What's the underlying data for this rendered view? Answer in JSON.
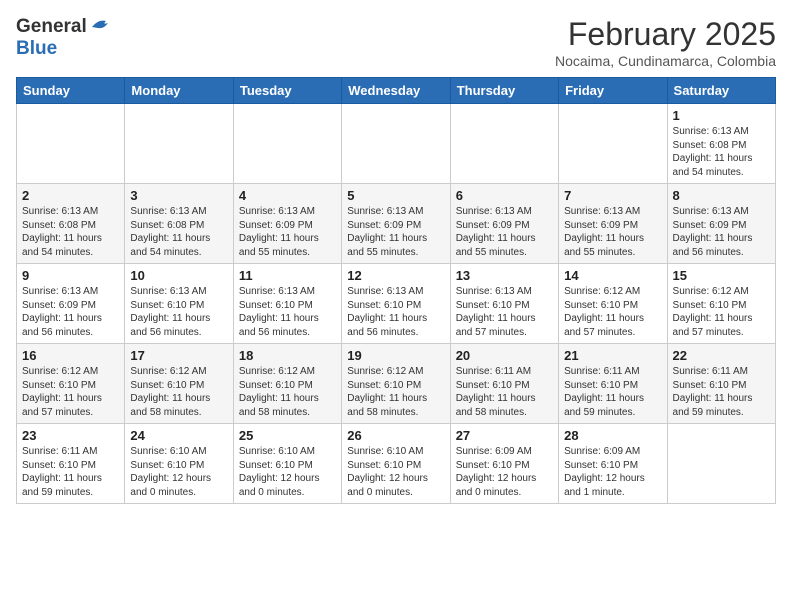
{
  "header": {
    "logo_general": "General",
    "logo_blue": "Blue",
    "month_title": "February 2025",
    "location": "Nocaima, Cundinamarca, Colombia"
  },
  "days_of_week": [
    "Sunday",
    "Monday",
    "Tuesday",
    "Wednesday",
    "Thursday",
    "Friday",
    "Saturday"
  ],
  "weeks": [
    {
      "days": [
        {
          "num": "",
          "info": ""
        },
        {
          "num": "",
          "info": ""
        },
        {
          "num": "",
          "info": ""
        },
        {
          "num": "",
          "info": ""
        },
        {
          "num": "",
          "info": ""
        },
        {
          "num": "",
          "info": ""
        },
        {
          "num": "1",
          "info": "Sunrise: 6:13 AM\nSunset: 6:08 PM\nDaylight: 11 hours and 54 minutes."
        }
      ]
    },
    {
      "days": [
        {
          "num": "2",
          "info": "Sunrise: 6:13 AM\nSunset: 6:08 PM\nDaylight: 11 hours and 54 minutes."
        },
        {
          "num": "3",
          "info": "Sunrise: 6:13 AM\nSunset: 6:08 PM\nDaylight: 11 hours and 54 minutes."
        },
        {
          "num": "4",
          "info": "Sunrise: 6:13 AM\nSunset: 6:09 PM\nDaylight: 11 hours and 55 minutes."
        },
        {
          "num": "5",
          "info": "Sunrise: 6:13 AM\nSunset: 6:09 PM\nDaylight: 11 hours and 55 minutes."
        },
        {
          "num": "6",
          "info": "Sunrise: 6:13 AM\nSunset: 6:09 PM\nDaylight: 11 hours and 55 minutes."
        },
        {
          "num": "7",
          "info": "Sunrise: 6:13 AM\nSunset: 6:09 PM\nDaylight: 11 hours and 55 minutes."
        },
        {
          "num": "8",
          "info": "Sunrise: 6:13 AM\nSunset: 6:09 PM\nDaylight: 11 hours and 56 minutes."
        }
      ]
    },
    {
      "days": [
        {
          "num": "9",
          "info": "Sunrise: 6:13 AM\nSunset: 6:09 PM\nDaylight: 11 hours and 56 minutes."
        },
        {
          "num": "10",
          "info": "Sunrise: 6:13 AM\nSunset: 6:10 PM\nDaylight: 11 hours and 56 minutes."
        },
        {
          "num": "11",
          "info": "Sunrise: 6:13 AM\nSunset: 6:10 PM\nDaylight: 11 hours and 56 minutes."
        },
        {
          "num": "12",
          "info": "Sunrise: 6:13 AM\nSunset: 6:10 PM\nDaylight: 11 hours and 56 minutes."
        },
        {
          "num": "13",
          "info": "Sunrise: 6:13 AM\nSunset: 6:10 PM\nDaylight: 11 hours and 57 minutes."
        },
        {
          "num": "14",
          "info": "Sunrise: 6:12 AM\nSunset: 6:10 PM\nDaylight: 11 hours and 57 minutes."
        },
        {
          "num": "15",
          "info": "Sunrise: 6:12 AM\nSunset: 6:10 PM\nDaylight: 11 hours and 57 minutes."
        }
      ]
    },
    {
      "days": [
        {
          "num": "16",
          "info": "Sunrise: 6:12 AM\nSunset: 6:10 PM\nDaylight: 11 hours and 57 minutes."
        },
        {
          "num": "17",
          "info": "Sunrise: 6:12 AM\nSunset: 6:10 PM\nDaylight: 11 hours and 58 minutes."
        },
        {
          "num": "18",
          "info": "Sunrise: 6:12 AM\nSunset: 6:10 PM\nDaylight: 11 hours and 58 minutes."
        },
        {
          "num": "19",
          "info": "Sunrise: 6:12 AM\nSunset: 6:10 PM\nDaylight: 11 hours and 58 minutes."
        },
        {
          "num": "20",
          "info": "Sunrise: 6:11 AM\nSunset: 6:10 PM\nDaylight: 11 hours and 58 minutes."
        },
        {
          "num": "21",
          "info": "Sunrise: 6:11 AM\nSunset: 6:10 PM\nDaylight: 11 hours and 59 minutes."
        },
        {
          "num": "22",
          "info": "Sunrise: 6:11 AM\nSunset: 6:10 PM\nDaylight: 11 hours and 59 minutes."
        }
      ]
    },
    {
      "days": [
        {
          "num": "23",
          "info": "Sunrise: 6:11 AM\nSunset: 6:10 PM\nDaylight: 11 hours and 59 minutes."
        },
        {
          "num": "24",
          "info": "Sunrise: 6:10 AM\nSunset: 6:10 PM\nDaylight: 12 hours and 0 minutes."
        },
        {
          "num": "25",
          "info": "Sunrise: 6:10 AM\nSunset: 6:10 PM\nDaylight: 12 hours and 0 minutes."
        },
        {
          "num": "26",
          "info": "Sunrise: 6:10 AM\nSunset: 6:10 PM\nDaylight: 12 hours and 0 minutes."
        },
        {
          "num": "27",
          "info": "Sunrise: 6:09 AM\nSunset: 6:10 PM\nDaylight: 12 hours and 0 minutes."
        },
        {
          "num": "28",
          "info": "Sunrise: 6:09 AM\nSunset: 6:10 PM\nDaylight: 12 hours and 1 minute."
        },
        {
          "num": "",
          "info": ""
        }
      ]
    }
  ]
}
